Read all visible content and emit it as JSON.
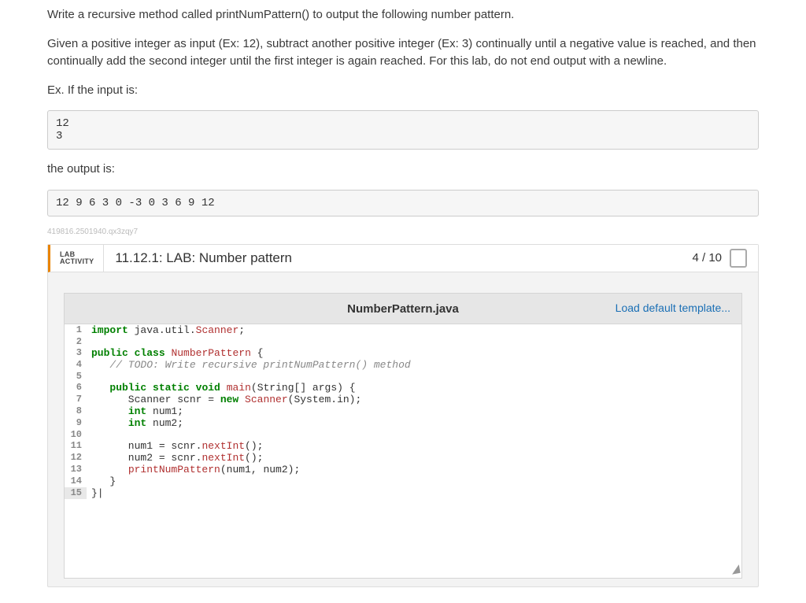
{
  "instructions": {
    "p1": "Write a recursive method called printNumPattern() to output the following number pattern.",
    "p2": "Given a positive integer as input (Ex: 12), subtract another positive integer (Ex: 3) continually until a negative value is reached, and then continually add the second integer until the first integer is again reached. For this lab, do not end output with a newline.",
    "p3": "Ex. If the input is:",
    "input_box": "12\n3",
    "p4": "the output is:",
    "output_box": "12 9 6 3 0 -3 0 3 6 9 12"
  },
  "watermark": "419816.2501940.qx3zqy7",
  "lab": {
    "badge_line1": "LAB",
    "badge_line2": "ACTIVITY",
    "title": "11.12.1: LAB: Number pattern",
    "score": "4 / 10",
    "filename": "NumberPattern.java",
    "load_template": "Load default template..."
  },
  "code": {
    "l1a": "import",
    "l1b": " java.util.",
    "l1c": "Scanner",
    "l1d": ";",
    "l2": "",
    "l3a": "public",
    "l3b": " ",
    "l3c": "class",
    "l3d": " ",
    "l3e": "NumberPattern",
    "l3f": " {",
    "l4": "   // TODO: Write recursive printNumPattern() method",
    "l5": "",
    "l6a": "   ",
    "l6b": "public",
    "l6c": " ",
    "l6d": "static",
    "l6e": " ",
    "l6f": "void",
    "l6g": " ",
    "l6h": "main",
    "l6i": "(String[] args) {",
    "l7a": "      Scanner scnr = ",
    "l7b": "new",
    "l7c": " ",
    "l7d": "Scanner",
    "l7e": "(System.in);",
    "l8a": "      ",
    "l8b": "int",
    "l8c": " num1;",
    "l9a": "      ",
    "l9b": "int",
    "l9c": " num2;",
    "l10": "",
    "l11a": "      num1 = scnr.",
    "l11b": "nextInt",
    "l11c": "();",
    "l12a": "      num2 = scnr.",
    "l12b": "nextInt",
    "l12c": "();",
    "l13a": "      ",
    "l13b": "printNumPattern",
    "l13c": "(num1, num2);",
    "l14": "   }",
    "l15": "}|"
  },
  "line_numbers": [
    "1",
    "2",
    "3",
    "4",
    "5",
    "6",
    "7",
    "8",
    "9",
    "10",
    "11",
    "12",
    "13",
    "14",
    "15"
  ]
}
